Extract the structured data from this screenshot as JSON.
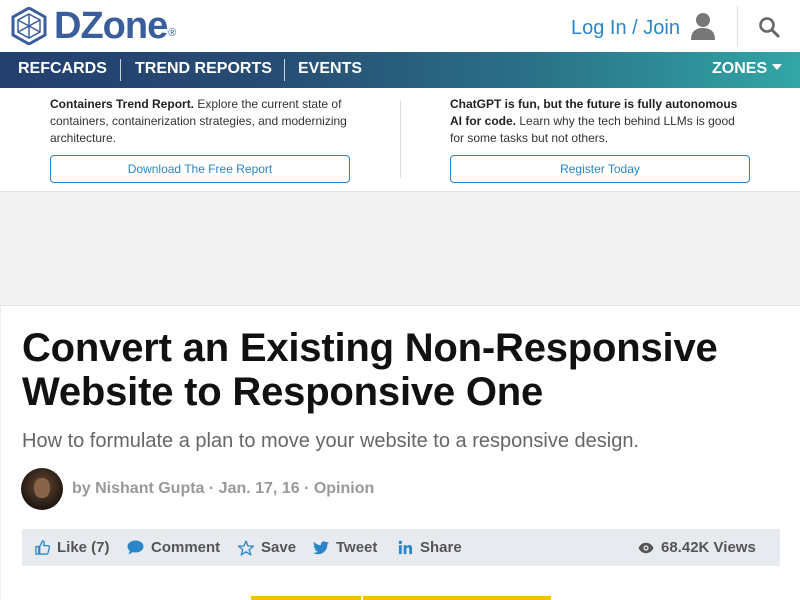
{
  "header": {
    "logo_text": "DZone",
    "logo_mark": "®",
    "login_label": "Log In / Join",
    "icons": {
      "user": "user-icon",
      "search": "search-icon"
    }
  },
  "nav": {
    "items": [
      "REFCARDS",
      "TREND REPORTS",
      "EVENTS"
    ],
    "zones_label": "ZONES"
  },
  "promos": [
    {
      "bold": "Containers Trend Report.",
      "text": " Explore the current state of containers, containerization strategies, and modernizing architecture.",
      "button": "Download The Free Report"
    },
    {
      "bold": "ChatGPT is fun, but the future is fully autonomous AI for code.",
      "text": " Learn why the tech behind LLMs is good for some tasks but not others.",
      "button": "Register Today"
    }
  ],
  "article": {
    "title": "Convert an Existing Non-Responsive Website to Responsive One",
    "subtitle": "How to formulate a plan to move your website to a responsive design.",
    "byline": "by Nishant Gupta · Jan. 17, 16 · Opinion"
  },
  "actions": {
    "like": "Like (7)",
    "comment": "Comment",
    "save": "Save",
    "tweet": "Tweet",
    "share": "Share",
    "views": "68.42K Views"
  },
  "colors": {
    "brand_blue": "#3a5e9c",
    "link_blue": "#2a86c9",
    "nav_start": "#233f6e",
    "nav_end": "#32a6a6",
    "accent_yellow": "#f2c200"
  }
}
